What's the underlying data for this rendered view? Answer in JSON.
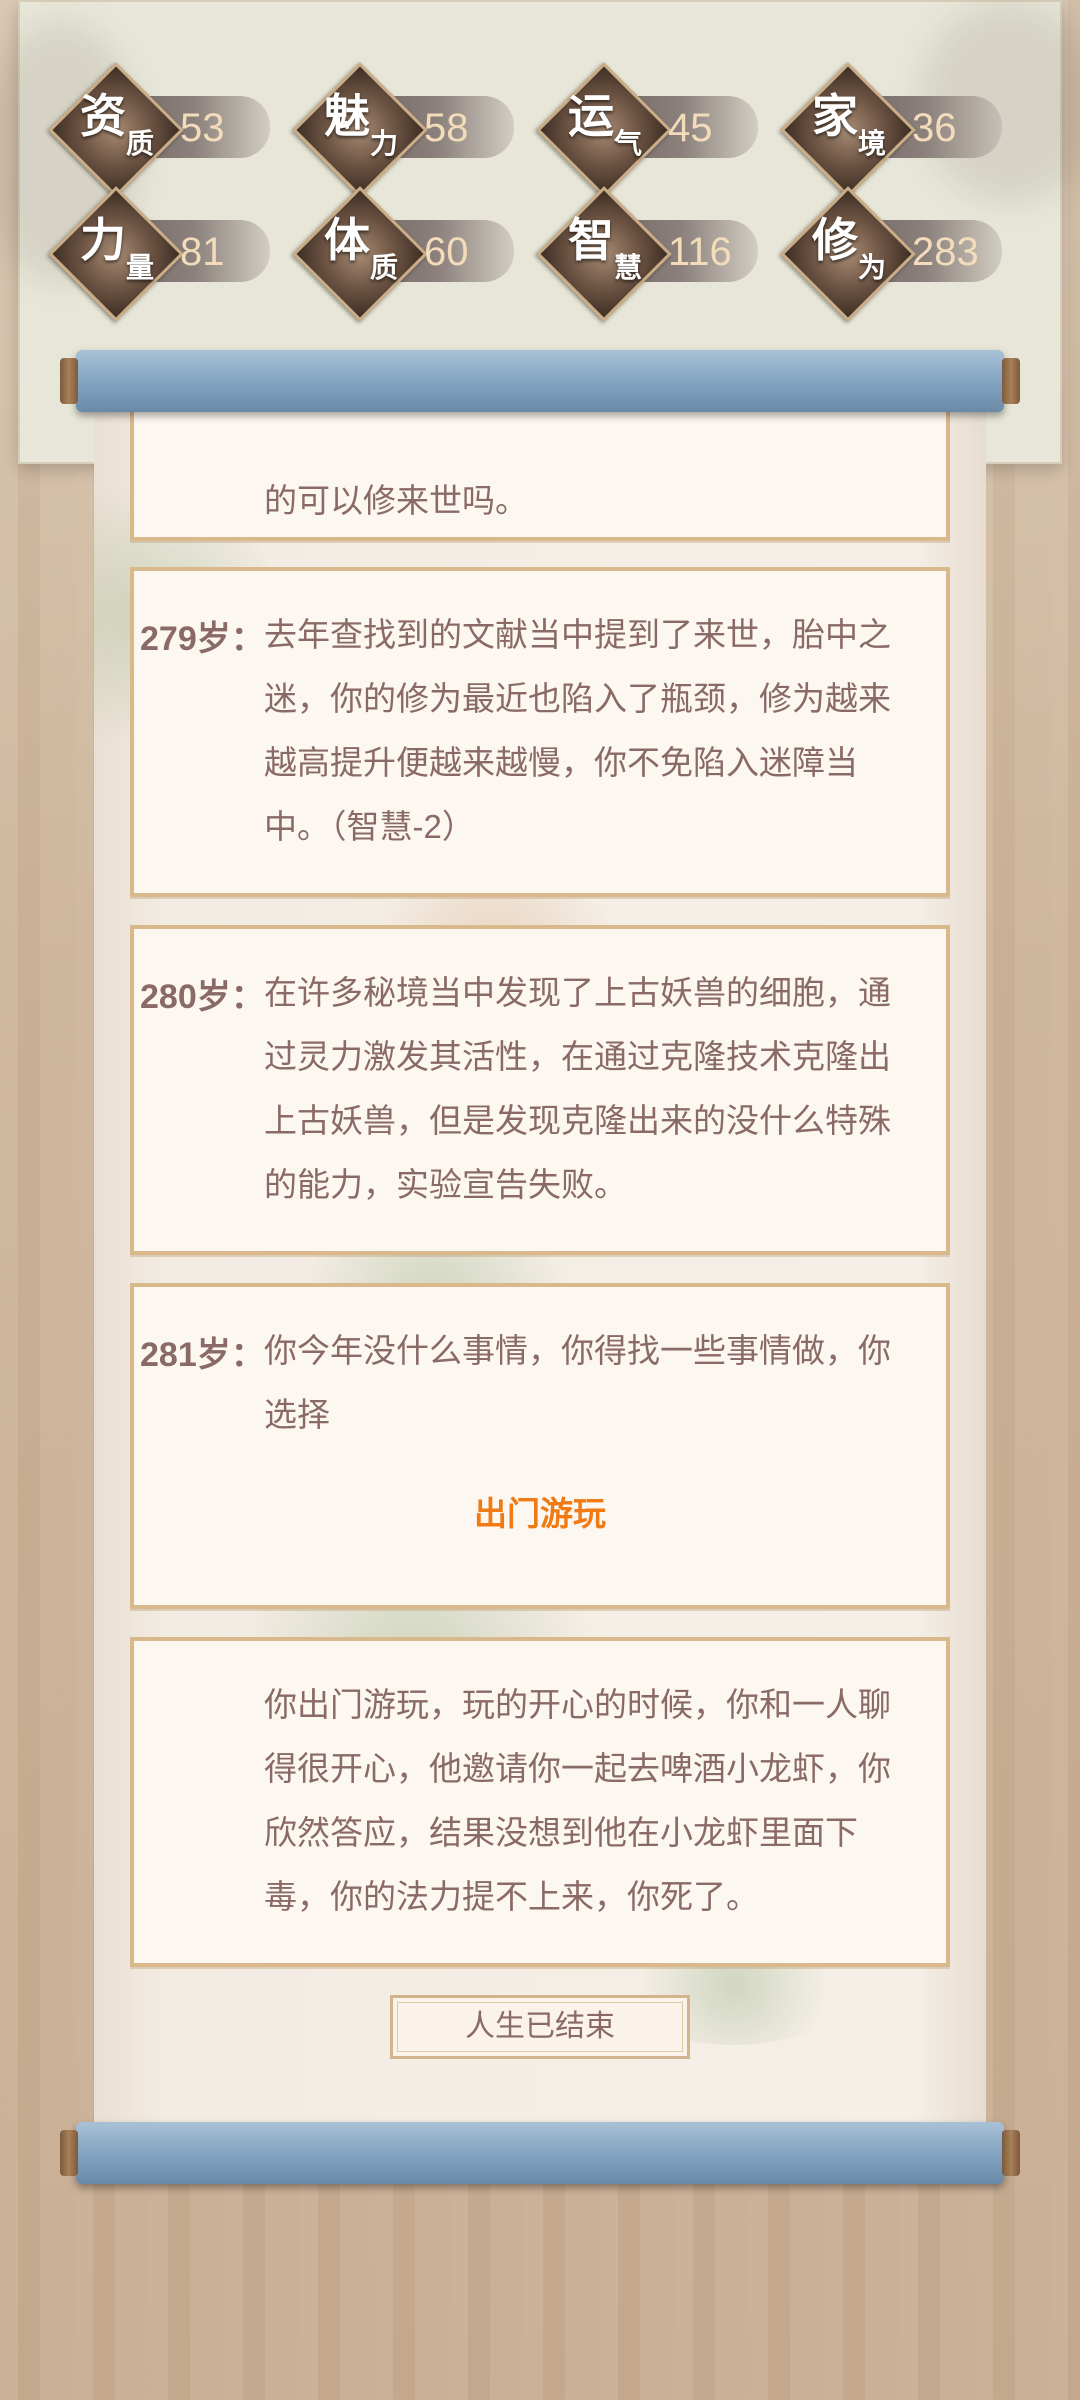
{
  "stats": [
    {
      "c1": "资",
      "c2": "质",
      "value": "53"
    },
    {
      "c1": "魅",
      "c2": "力",
      "value": "58"
    },
    {
      "c1": "运",
      "c2": "气",
      "value": "45"
    },
    {
      "c1": "家",
      "c2": "境",
      "value": "36"
    },
    {
      "c1": "力",
      "c2": "量",
      "value": "81"
    },
    {
      "c1": "体",
      "c2": "质",
      "value": "60"
    },
    {
      "c1": "智",
      "c2": "慧",
      "value": "116"
    },
    {
      "c1": "修",
      "c2": "为",
      "value": "283"
    }
  ],
  "events": {
    "partial_text": "的可以修来世吗。",
    "e279": {
      "age": "279岁：",
      "text": "去年查找到的文献当中提到了来世，胎中之迷，你的修为最近也陷入了瓶颈，修为越来越高提升便越来越慢，你不免陷入迷障当中。（智慧-2）"
    },
    "e280": {
      "age": "280岁：",
      "text": "在许多秘境当中发现了上古妖兽的细胞，通过灵力激发其活性，在通过克隆技术克隆出上古妖兽，但是发现克隆出来的没什么特殊的能力，实验宣告失败。"
    },
    "e281": {
      "age": "281岁：",
      "text": "你今年没什么事情，你得找一些事情做，你选择",
      "choice": "出门游玩"
    },
    "result": {
      "text": "你出门游玩，玩的开心的时候，你和一人聊得很开心，他邀请你一起去啤酒小龙虾，你欣然答应，结果没想到他在小龙虾里面下毒，你的法力提不上来，你死了。"
    }
  },
  "end_button": "人生已结束",
  "colors": {
    "text": "#8a6a66",
    "choice": "#f07a14",
    "card_border": "#d9b88b",
    "rod": "#7e9fbd"
  }
}
